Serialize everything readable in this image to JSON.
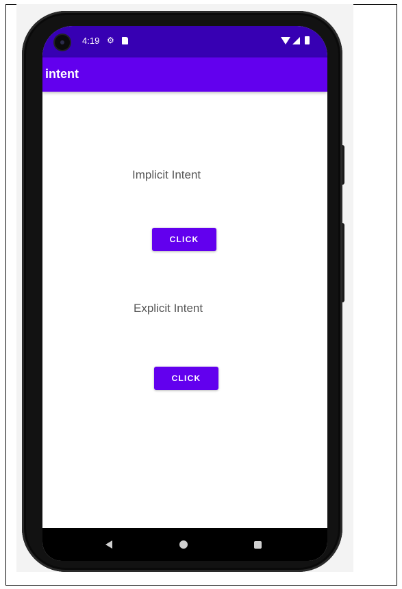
{
  "status_bar": {
    "time": "4:19"
  },
  "app_bar": {
    "title": "intent"
  },
  "content": {
    "implicit_label": "Implicit Intent",
    "implicit_button": "CLICK",
    "explicit_label": "Explicit Intent",
    "explicit_button": "CLICK"
  },
  "colors": {
    "status_bar": "#3700b3",
    "app_bar": "#6200ee",
    "button": "#6200ee"
  },
  "icons": [
    "camera-icon",
    "settings-gear-icon",
    "sd-card-icon",
    "wifi-icon",
    "signal-icon",
    "battery-icon",
    "back-icon",
    "home-icon",
    "recents-icon"
  ]
}
